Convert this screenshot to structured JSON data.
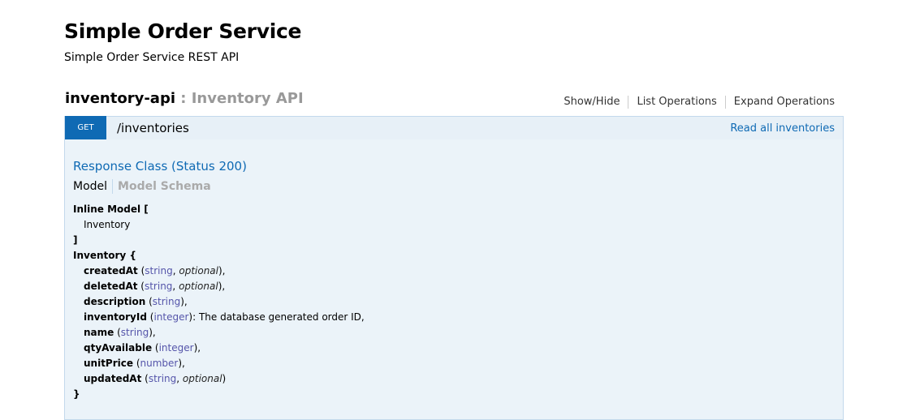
{
  "app": {
    "title": "Simple Order Service",
    "subtitle": "Simple Order Service REST API"
  },
  "resource": {
    "name": "inventory-api",
    "separator": " : ",
    "description": "Inventory API",
    "ops": [
      "Show/Hide",
      "List Operations",
      "Expand Operations"
    ]
  },
  "operation": {
    "method": "GET",
    "path": "/inventories",
    "summary": "Read all inventories",
    "response_title": "Response Class (Status 200)",
    "tabs": [
      "Model",
      "Model Schema"
    ]
  },
  "model": {
    "inline_open": "Inline Model [",
    "inline_item": "Inventory",
    "inline_close": "]",
    "name_open": "Inventory {",
    "close": "}",
    "fields": [
      {
        "name": "createdAt",
        "type": "string",
        "optional": "optional",
        "desc": "",
        "end": "),"
      },
      {
        "name": "deletedAt",
        "type": "string",
        "optional": "optional",
        "desc": "",
        "end": "),"
      },
      {
        "name": "description",
        "type": "string",
        "optional": "",
        "desc": "",
        "end": "),"
      },
      {
        "name": "inventoryId",
        "type": "integer",
        "optional": "",
        "desc": ": The database generated order ID,",
        "end": ")"
      },
      {
        "name": "name",
        "type": "string",
        "optional": "",
        "desc": "",
        "end": "),"
      },
      {
        "name": "qtyAvailable",
        "type": "integer",
        "optional": "",
        "desc": "",
        "end": "),"
      },
      {
        "name": "unitPrice",
        "type": "number",
        "optional": "",
        "desc": "",
        "end": "),"
      },
      {
        "name": "updatedAt",
        "type": "string",
        "optional": "optional",
        "desc": "",
        "end": ")"
      }
    ]
  }
}
